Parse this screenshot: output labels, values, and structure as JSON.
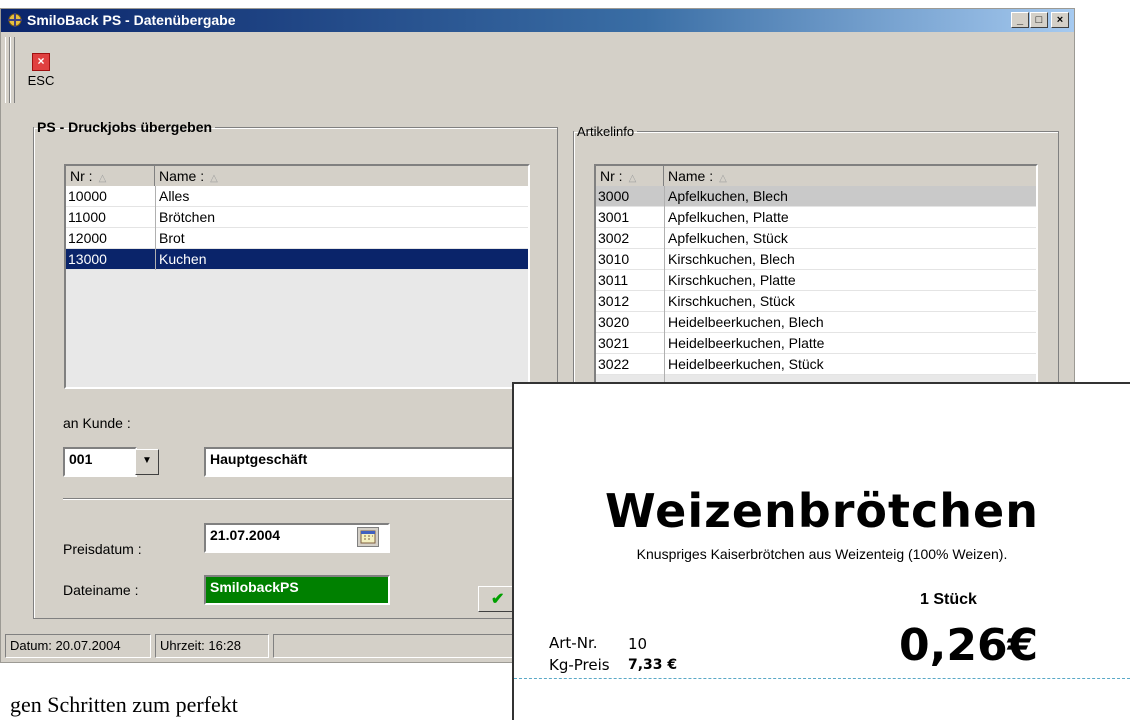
{
  "window": {
    "title": "SmiloBack PS - Datenübergabe",
    "controls": {
      "minimize": "_",
      "maximize": "□",
      "close": "×"
    }
  },
  "toolbar": {
    "esc_label": "ESC"
  },
  "left_group": {
    "legend": "PS - Druckjobs übergeben",
    "columns": [
      "Nr :",
      "Name :"
    ],
    "rows": [
      {
        "nr": "10000",
        "name": "Alles"
      },
      {
        "nr": "11000",
        "name": "Brötchen"
      },
      {
        "nr": "12000",
        "name": "Brot"
      },
      {
        "nr": "13000",
        "name": "Kuchen"
      }
    ],
    "selected_index": 3,
    "kunde_label": "an Kunde :",
    "kunde_code": "001",
    "kunde_name": "Hauptgeschäft",
    "preisdatum_label": "Preisdatum :",
    "preisdatum_value": "21.07.2004",
    "dateiname_label": "Dateiname :",
    "dateiname_value": "SmilobackPS"
  },
  "right_group": {
    "legend": "Artikelinfo",
    "columns": [
      "Nr :",
      "Name :"
    ],
    "rows": [
      {
        "nr": "3000",
        "name": "Apfelkuchen, Blech"
      },
      {
        "nr": "3001",
        "name": "Apfelkuchen, Platte"
      },
      {
        "nr": "3002",
        "name": "Apfelkuchen, Stück"
      },
      {
        "nr": "3010",
        "name": "Kirschkuchen, Blech"
      },
      {
        "nr": "3011",
        "name": "Kirschkuchen, Platte"
      },
      {
        "nr": "3012",
        "name": "Kirschkuchen, Stück"
      },
      {
        "nr": "3020",
        "name": "Heidelbeerkuchen, Blech"
      },
      {
        "nr": "3021",
        "name": "Heidelbeerkuchen, Platte"
      },
      {
        "nr": "3022",
        "name": "Heidelbeerkuchen, Stück"
      }
    ],
    "highlighted_index": 0
  },
  "statusbar": {
    "datum": "Datum: 20.07.2004",
    "uhrzeit": "Uhrzeit: 16:28"
  },
  "price_label": {
    "product": "Weizenbrötchen",
    "description": "Knuspriges Kaiserbrötchen aus Weizenteig (100% Weizen).",
    "unit": "1 Stück",
    "artnr_label": "Art-Nr.",
    "artnr_value": "10",
    "kgpreis_label": "Kg-Preis",
    "kgpreis_value": "7,33 €",
    "price": "0,26€"
  },
  "page_text": "gen Schritten zum perfekt",
  "colors": {
    "selection": "#0a246a",
    "filename_bg": "#008000",
    "dash_line": "#5aa9c7"
  }
}
